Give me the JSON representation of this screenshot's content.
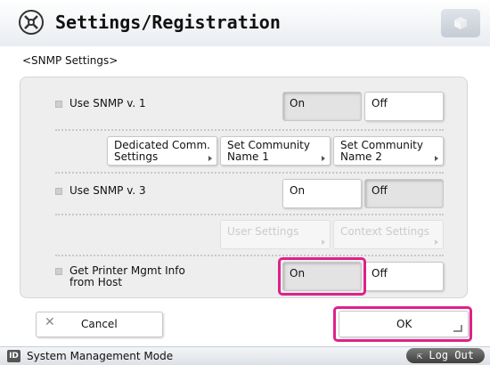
{
  "header": {
    "title": "Settings/Registration",
    "title_icon": "settings-wrench-icon",
    "corner_icon": "cube-icon"
  },
  "subtitle": "<SNMP Settings>",
  "rows": {
    "snmp_v1": {
      "label": "Use SNMP v. 1",
      "on_label": "On",
      "off_label": "Off",
      "selected": "On"
    },
    "v1_buttons": {
      "dedicated_line1": "Dedicated Comm.",
      "dedicated_line2": "Settings",
      "community1_line1": "Set Community",
      "community1_line2": "Name 1",
      "community2_line1": "Set Community",
      "community2_line2": "Name 2"
    },
    "snmp_v3": {
      "label": "Use SNMP v. 3",
      "on_label": "On",
      "off_label": "Off",
      "selected": "Off"
    },
    "v3_buttons": {
      "user_settings": "User Settings",
      "context_settings": "Context Settings"
    },
    "printer_mgmt": {
      "label_line1": "Get Printer Mgmt Info",
      "label_line2": "from Host",
      "on_label": "On",
      "off_label": "Off",
      "selected": "On"
    }
  },
  "actions": {
    "cancel_label": "Cancel",
    "ok_label": "OK"
  },
  "footer": {
    "badge": "ID",
    "mode_text": "System Management Mode",
    "logout_label": "Log Out"
  },
  "colors": {
    "highlight": "#e0218a",
    "selected_button": "#e3e3e3",
    "panel": "#eeeeee"
  }
}
